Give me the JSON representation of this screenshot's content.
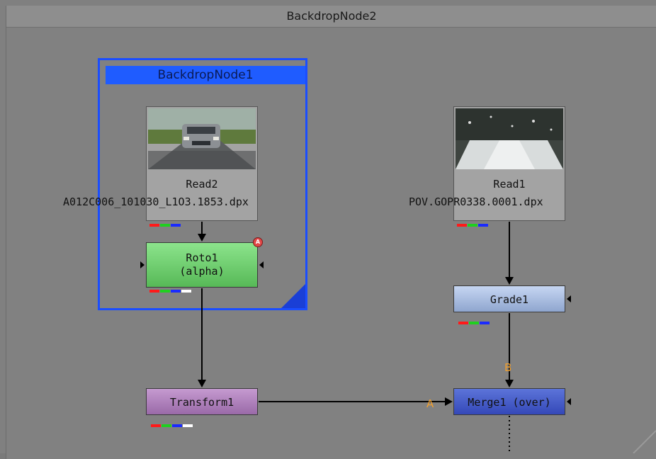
{
  "backdrops": {
    "outer_title": "BackdropNode2",
    "inner_title": "BackdropNode1"
  },
  "nodes": {
    "read2": {
      "name": "Read2",
      "file": "A012C006_101030_L1O3.1853.dpx"
    },
    "read1": {
      "name": "Read1",
      "file": "POV.GOPR0338.0001.dpx"
    },
    "roto": {
      "line1": "Roto1",
      "line2": "(alpha)",
      "badge": "A"
    },
    "grade": {
      "name": "Grade1"
    },
    "transform": {
      "name": "Transform1"
    },
    "merge": {
      "name": "Merge1 (over)"
    }
  },
  "pins": {
    "a_label": "A",
    "b_label": "B"
  },
  "colors": {
    "backdrop1_border": "#1a4dff",
    "backdrop1_title": "#1f5cff",
    "roto": "#6ecf6e",
    "grade": "#a9bde3",
    "transform": "#b380c0",
    "merge": "#4159c9",
    "pin_label": "#f0a030",
    "channel_red": "#ff1a1a",
    "channel_green": "#1fd01f",
    "channel_blue": "#1a2bff",
    "channel_white": "#ffffff"
  }
}
